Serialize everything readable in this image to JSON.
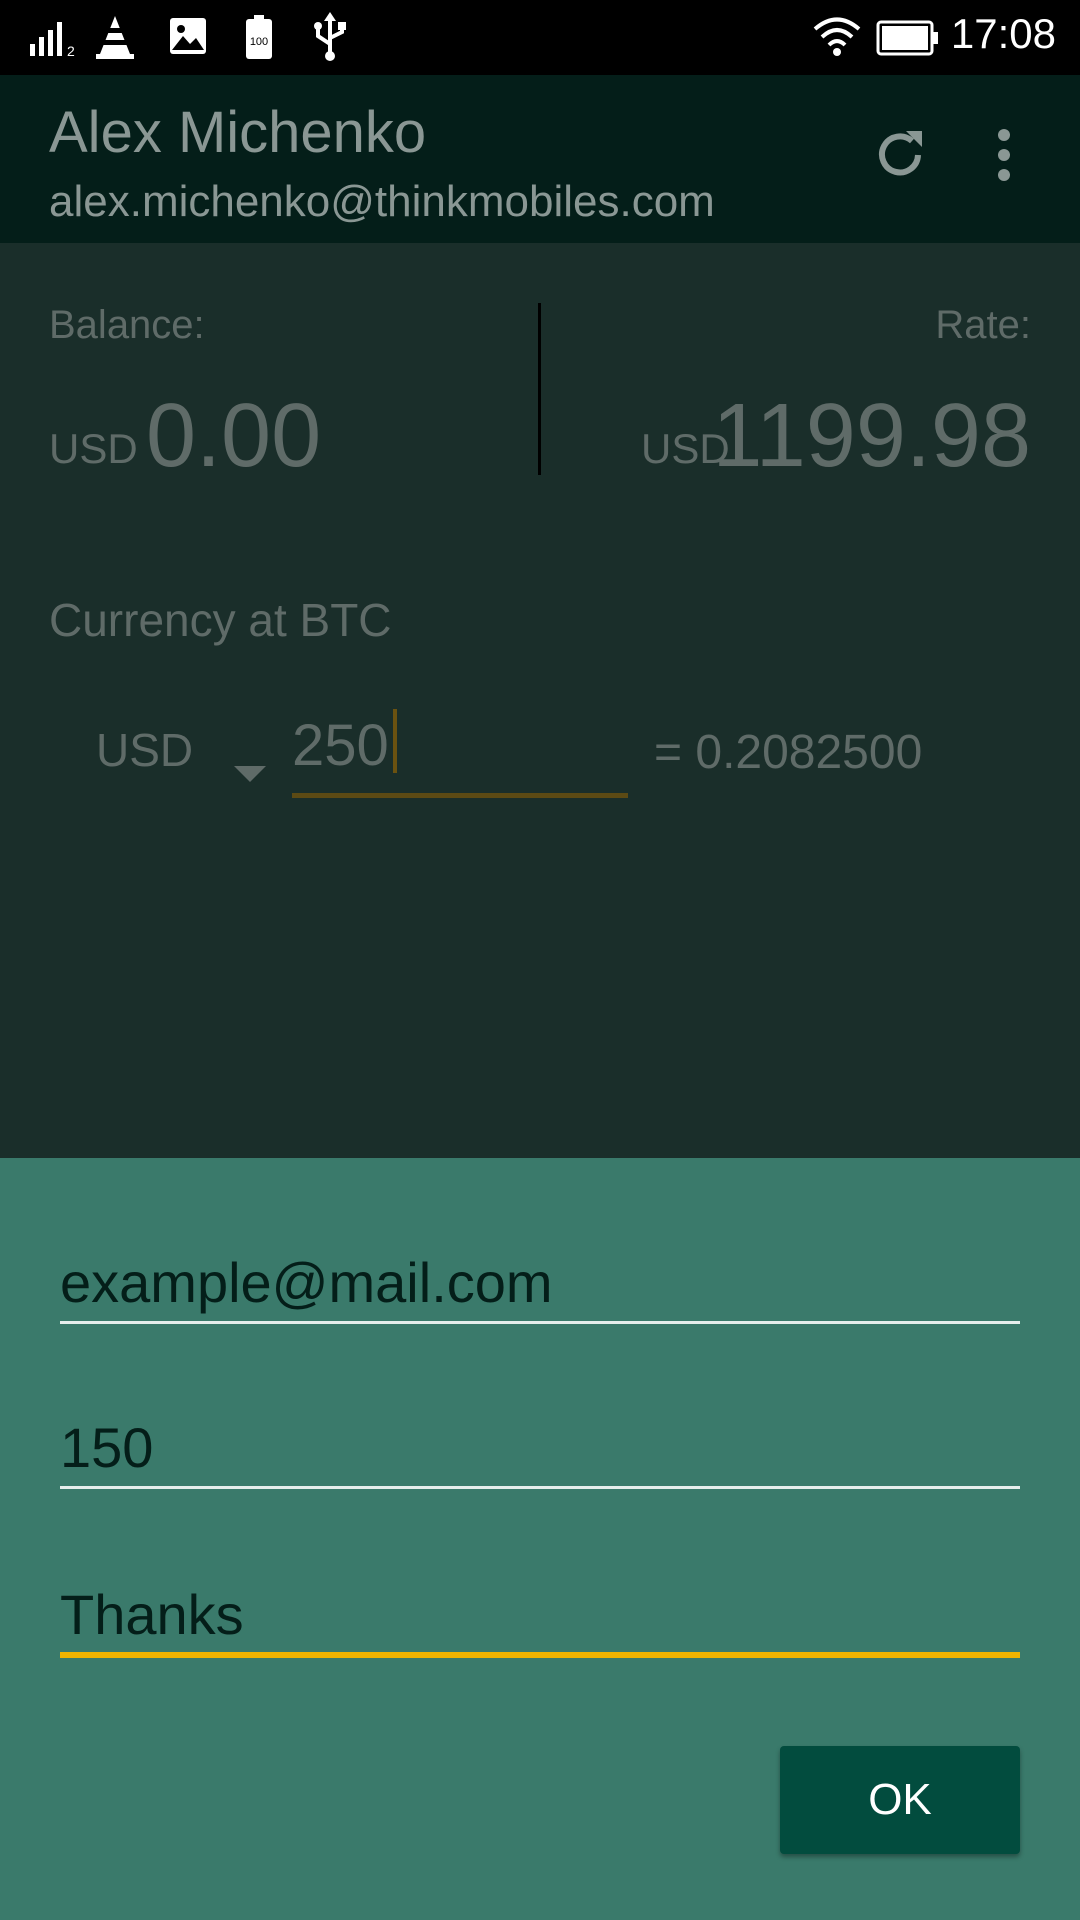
{
  "status_bar": {
    "time": "17:08",
    "battery_icon_text": "100",
    "icons": [
      "signal-icon",
      "vlc-icon",
      "gallery-icon",
      "battery-saver-icon",
      "usb-icon",
      "wifi-icon",
      "battery-icon"
    ]
  },
  "header": {
    "name": "Alex Michenko",
    "email": "alex.michenko@thinkmobiles.com",
    "actions": [
      "refresh-icon",
      "more-options-icon"
    ]
  },
  "balance": {
    "label": "Balance:",
    "currency": "USD",
    "value": "0.00"
  },
  "rate": {
    "label": "Rate:",
    "currency": "USD",
    "value": "1199.98"
  },
  "converter": {
    "title": "Currency at BTC",
    "currency": "USD",
    "amount": "250",
    "result": "= 0.2082500"
  },
  "dialog": {
    "email_value": "example@mail.com",
    "amount_value": "150",
    "message_value": "Thanks",
    "ok_label": "OK"
  },
  "colors": {
    "appbar": "#041e19",
    "background": "#1a2e2a",
    "sheet": "#3a7a6b",
    "accent": "#f0b400",
    "button": "#024c3e"
  }
}
